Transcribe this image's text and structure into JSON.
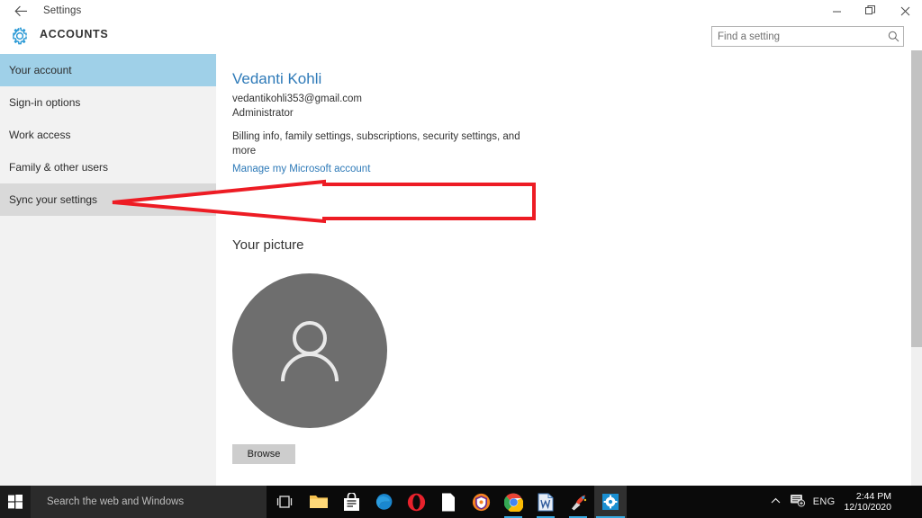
{
  "window": {
    "titlebar_label": "Settings",
    "back_icon": "back-arrow-icon",
    "minimize_label": "Minimize",
    "restore_label": "Restore",
    "close_label": "Close"
  },
  "header": {
    "icon": "gear-icon",
    "title": "ACCOUNTS"
  },
  "search": {
    "placeholder": "Find a setting",
    "value": "",
    "icon": "search-icon"
  },
  "sidebar": {
    "items": [
      {
        "label": "Your account",
        "state": "selected"
      },
      {
        "label": "Sign-in options",
        "state": "normal"
      },
      {
        "label": "Work access",
        "state": "normal"
      },
      {
        "label": "Family & other users",
        "state": "normal"
      },
      {
        "label": "Sync your settings",
        "state": "hover"
      }
    ]
  },
  "account": {
    "name": "Vedanti Kohli",
    "email": "vedantikohli353@gmail.com",
    "role": "Administrator",
    "description": "Billing info, family settings, subscriptions, security settings, and more",
    "manage_link": "Manage my Microsoft account"
  },
  "picture": {
    "heading": "Your picture",
    "avatar_icon": "person-avatar-icon",
    "browse_label": "Browse"
  },
  "scrollbar": {
    "up_arrow_icon": "scroll-up-arrow-icon"
  },
  "annotation": {
    "type": "red-left-arrow",
    "color": "#ed1c24",
    "points_to": "Sync your settings"
  },
  "taskbar": {
    "start_icon": "windows-start-icon",
    "search_placeholder": "Search the web and Windows",
    "task_view_icon": "task-view-icon",
    "apps": [
      {
        "name": "file-explorer-icon",
        "label": "File Explorer",
        "state": "normal"
      },
      {
        "name": "microsoft-store-icon",
        "label": "Store",
        "state": "normal"
      },
      {
        "name": "edge-icon",
        "label": "Microsoft Edge",
        "state": "normal"
      },
      {
        "name": "opera-icon",
        "label": "Opera",
        "state": "normal"
      },
      {
        "name": "document-icon",
        "label": "Document",
        "state": "normal"
      },
      {
        "name": "avast-shield-icon",
        "label": "Avast",
        "state": "normal"
      },
      {
        "name": "chrome-icon",
        "label": "Google Chrome",
        "state": "running"
      },
      {
        "name": "word-document-icon",
        "label": "Word",
        "state": "running"
      },
      {
        "name": "paint-icon",
        "label": "Paint",
        "state": "running"
      },
      {
        "name": "settings-gear-icon",
        "label": "Settings",
        "state": "active"
      }
    ],
    "tray": {
      "chevron_icon": "chevron-up-icon",
      "network_icon": "notification-network-icon",
      "language": "ENG",
      "time": "2:44 PM",
      "date": "12/10/2020"
    }
  }
}
